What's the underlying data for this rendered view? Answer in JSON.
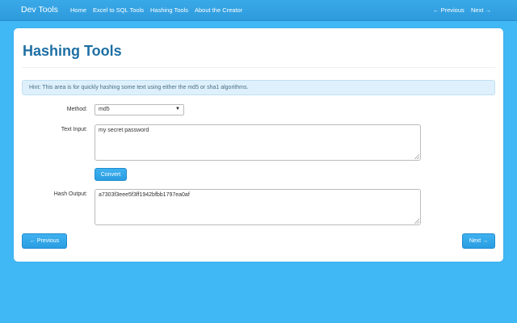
{
  "navbar": {
    "brand": "Dev Tools",
    "links": [
      "Home",
      "Excel to SQL Tools",
      "Hashing Tools",
      "About the Creator"
    ],
    "prev": "← Previous",
    "next": "Next →"
  },
  "page": {
    "title": "Hashing Tools",
    "hint": "Hint: This area is for quickly hashing some text using either the md5 or sha1 algorithms."
  },
  "form": {
    "method_label": "Method:",
    "method_value": "md5",
    "text_label": "Text Input:",
    "text_value": "my secret password",
    "convert_label": "Convert",
    "hash_label": "Hash Output:",
    "hash_value": "a7303f3eee5f3ff1942bfbb1797ea0af"
  },
  "pager": {
    "prev": "← Previous",
    "next": "Next →"
  },
  "colors": {
    "background": "#41b8f6",
    "navbar": "#2e9bdc",
    "title": "#1e6fa3",
    "button": "#2a9ee2"
  }
}
